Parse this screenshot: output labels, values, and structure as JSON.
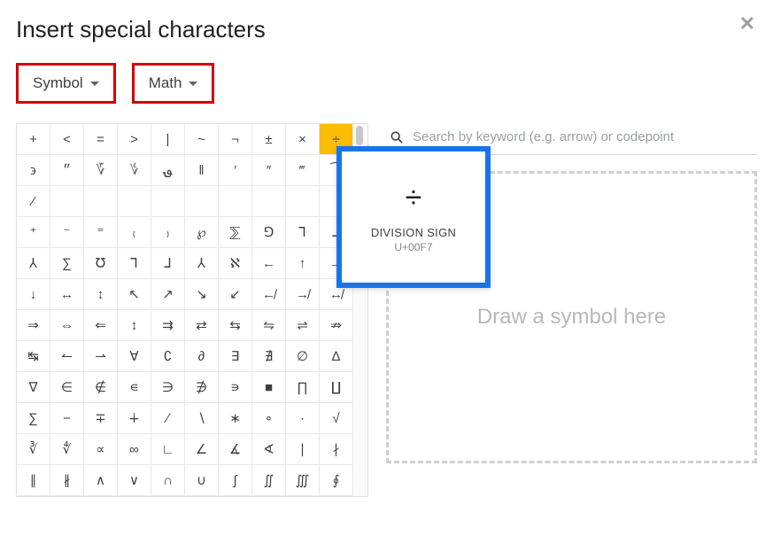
{
  "dialog": {
    "title": "Insert special characters"
  },
  "dropdowns": {
    "category": "Symbol",
    "subcategory": "Math"
  },
  "search": {
    "placeholder": "Search by keyword (e.g. arrow) or codepoint"
  },
  "drawbox": {
    "placeholder": "Draw a symbol here"
  },
  "tooltip": {
    "glyph": "÷",
    "name": "DIVISION SIGN",
    "codepoint": "U+00F7"
  },
  "selected_index": 9,
  "grid": [
    "+",
    "<",
    "=",
    ">",
    "|",
    "~",
    "¬",
    "±",
    "×",
    "÷",
    "϶",
    "״",
    "؆",
    "؇",
    "؈",
    "‖",
    "′",
    "″",
    "‴",
    "⁀",
    "⁄",
    "",
    "",
    "",
    "",
    "",
    "",
    "",
    "",
    "",
    "⁺",
    "⁻",
    "⁼",
    "₍",
    "₎",
    "℘",
    "⅀",
    "⅁",
    "⅂",
    "⅃",
    "⅄",
    "∑",
    "℧",
    "⅂",
    "⅃",
    "⅄",
    "ℵ",
    "←",
    "↑",
    "→",
    "↓",
    "↔",
    "↕",
    "↖",
    "↗",
    "↘",
    "↙",
    "↚",
    "↛",
    "↮",
    "⇒",
    "⇔",
    "⇐",
    "↕",
    "⇉",
    "⇄",
    "⇆",
    "⇋",
    "⇌",
    "⇏",
    "↹",
    "↼",
    "⇀",
    "∀",
    "∁",
    "∂",
    "∃",
    "∄",
    "∅",
    "∆",
    "∇",
    "∈",
    "∉",
    "∊",
    "∋",
    "∌",
    "∍",
    "■",
    "∏",
    "∐",
    "∑",
    "−",
    "∓",
    "∔",
    "∕",
    "∖",
    "∗",
    "∘",
    "∙",
    "√",
    "∛",
    "∜",
    "∝",
    "∞",
    "∟",
    "∠",
    "∡",
    "∢",
    "∣",
    "∤",
    "∥",
    "∦",
    "∧",
    "∨",
    "∩",
    "∪",
    "∫",
    "∬",
    "∭",
    "∮"
  ]
}
